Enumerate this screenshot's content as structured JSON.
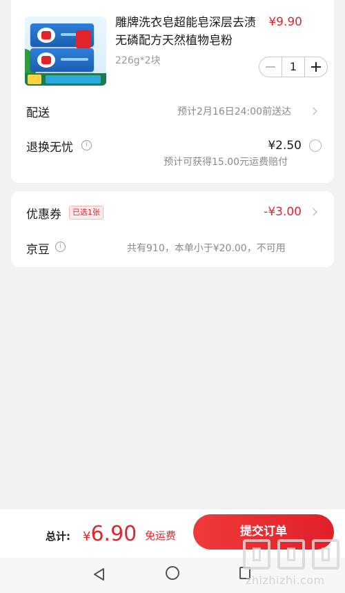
{
  "product": {
    "title": "雕牌洗衣皂超能皂深层去渍无磷配方天然植物皂粉",
    "price": "¥9.90",
    "spec": "226g*2块",
    "quantity": "1"
  },
  "delivery": {
    "label": "配送",
    "value": "预计2月16日24:00前送达"
  },
  "return_service": {
    "label": "退换无忧",
    "price": "¥2.50",
    "note": "预计可获得15.00元运费赔付"
  },
  "coupon": {
    "label": "优惠券",
    "badge": "已选1张",
    "value": "-¥3.00"
  },
  "jingdou": {
    "label": "京豆",
    "value": "共有910，本单小于¥20.00，不可用"
  },
  "footer": {
    "total_label": "总计:",
    "currency": "¥",
    "total_amount": "6.90",
    "shipping_note": "免运费",
    "submit_label": "提交订单"
  },
  "watermark": {
    "text": "zhizhizhi.com"
  },
  "icons": {
    "info": "info-icon",
    "chevron": "chevron-right-icon",
    "back": "back-triangle-icon",
    "home": "home-circle-icon",
    "recent": "recent-apps-icon"
  },
  "colors": {
    "accent_red": "#e0262f",
    "background": "#f2f2f2",
    "card": "#ffffff"
  }
}
